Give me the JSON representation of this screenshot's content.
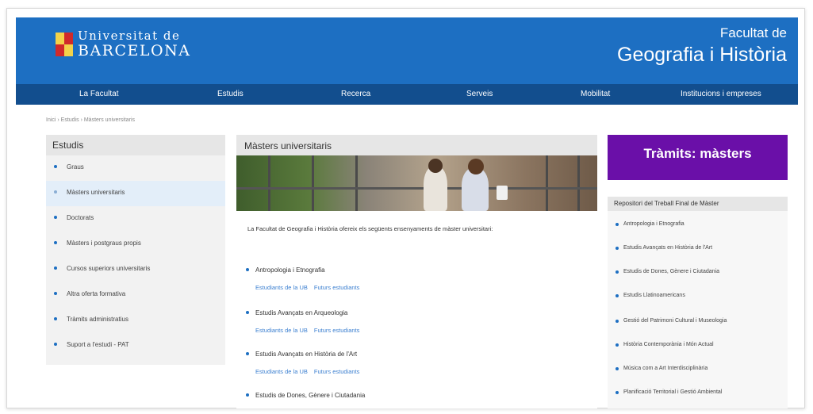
{
  "header": {
    "logo_line1": "Universitat de",
    "logo_line2": "BARCELONA",
    "faculty_line1": "Facultat de",
    "faculty_line2": "Geografia i Història"
  },
  "nav": {
    "items": [
      "La Facultat",
      "Estudis",
      "Recerca",
      "Serveis",
      "Mobilitat",
      "Institucions i empreses"
    ]
  },
  "breadcrumb": "Inici › Estudis › Màsters universitaris",
  "sidebar": {
    "title": "Estudis",
    "items": [
      {
        "label": "Graus",
        "active": false
      },
      {
        "label": "Màsters universitaris",
        "active": true
      },
      {
        "label": "Doctorats",
        "active": false
      },
      {
        "label": "Màsters i postgraus propis",
        "active": false
      },
      {
        "label": "Cursos superiors universitaris",
        "active": false
      },
      {
        "label": "Altra oferta formativa",
        "active": false
      },
      {
        "label": "Tràmits administratius",
        "active": false
      },
      {
        "label": "Suport a l'estudi - PAT",
        "active": false
      }
    ]
  },
  "main": {
    "title": "Màsters universitaris",
    "intro": "La Facultat de Geografia i Història ofereix els següents ensenyaments de màster universitari:",
    "programs": [
      {
        "name": "Antropologia i Etnografia",
        "links": [
          "Estudiants de la UB",
          "Futurs estudiants"
        ]
      },
      {
        "name": "Estudis Avançats en Arqueologia",
        "links": [
          "Estudiants de la UB",
          "Futurs estudiants"
        ]
      },
      {
        "name": "Estudis Avançats en Història de l'Art",
        "links": [
          "Estudiants de la UB",
          "Futurs estudiants"
        ]
      },
      {
        "name": "Estudis de Dones, Gènere i Ciutadania",
        "links": []
      }
    ]
  },
  "right": {
    "tramits_label": "Tràmits: màsters",
    "repo_title": "Repositori del Treball Final de Màster",
    "repo_items": [
      "Antropologia i Etnografia",
      "Estudis Avançats en Història de l'Art",
      "Estudis de Dones, Gènere i Ciutadania",
      "Estudis Llatinoamericans",
      "Gestió del Patrimoni Cultural i Museologia",
      "Història Contemporània i Món Actual",
      "Música com a Art Interdisciplinària",
      "Planificació Territorial i Gestió Ambiental"
    ]
  },
  "colors": {
    "header_blue": "#1d6fc2",
    "nav_blue": "#124e8e",
    "tramits_purple": "#6a0fa8",
    "link_blue": "#3b7fd0"
  }
}
